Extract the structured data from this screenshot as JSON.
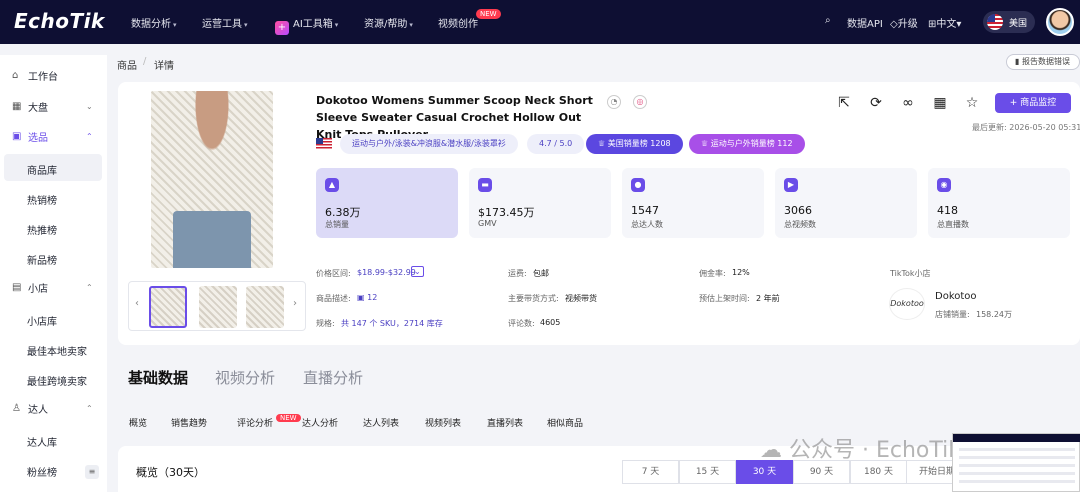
{
  "brand": "EchoTik",
  "nav": {
    "items": [
      "数据分析",
      "运营工具",
      "AI工具箱",
      "资源/帮助",
      "视频创作"
    ],
    "new_badge": "NEW",
    "right": {
      "api": "数据API",
      "upgrade": "升级",
      "language": "中文",
      "region": "美国"
    }
  },
  "sidebar": {
    "workbench": "工作台",
    "dashboard": "大盘",
    "select": "选品",
    "select_items": [
      "商品库",
      "热销榜",
      "热推榜",
      "新品榜"
    ],
    "shop": "小店",
    "shop_items": [
      "小店库",
      "最佳本地卖家",
      "最佳跨境卖家"
    ],
    "creator": "达人",
    "creator_items": [
      "达人库",
      "粉丝榜"
    ]
  },
  "breadcrumb": {
    "root": "商品",
    "current": "详情"
  },
  "report_error": "报告数据错误",
  "product": {
    "title": "Dokotoo Womens Summer Scoop Neck Short Sleeve Sweater Casual Crochet Hollow Out Knit Tops Pullover...",
    "monitor_label": "+ 商品监控",
    "last_updated": "最后更新: 2026-05-20 05:31",
    "category": "运动与户外/泳装&冲浪服&潜水服/泳装罩衫",
    "rating": "4.7 / 5.0",
    "rank_us": "美国销量榜  1208",
    "rank_outdoor": "运动与户外销量榜  112"
  },
  "stats": [
    {
      "value": "6.38万",
      "label": "总销量"
    },
    {
      "value": "$173.45万",
      "label": "GMV"
    },
    {
      "value": "1547",
      "label": "总达人数"
    },
    {
      "value": "3066",
      "label": "总视频数"
    },
    {
      "value": "418",
      "label": "总直播数"
    }
  ],
  "info": {
    "price_range_label": "价格区间:",
    "price_range": "$18.99-$32.99",
    "shipping_label": "运费:",
    "shipping": "包邮",
    "commission_label": "佣金率:",
    "commission": "12%",
    "tiktok_shop_label": "TikTok小店",
    "desc_label": "商品描述:",
    "desc": "12",
    "channel_label": "主要带货方式:",
    "channel": "视频带货",
    "listed_label": "预估上架时间:",
    "listed": "2 年前",
    "shop_name": "Dokotoo",
    "shop_logo_text": "Dokotoo",
    "shop_sales_label": "店铺销量:",
    "shop_sales": "158.24万",
    "spec_label": "规格:",
    "spec": "共 147 个 SKU，2714 库存",
    "reviews_label": "评论数:",
    "reviews": "4605"
  },
  "tabs": [
    "基础数据",
    "视频分析",
    "直播分析"
  ],
  "sub_tabs": [
    "概览",
    "销售趋势",
    "评论分析",
    "达人分析",
    "达人列表",
    "视频列表",
    "直播列表",
    "相似商品"
  ],
  "overview": {
    "title": "概览（30天）",
    "ranges": [
      "7 天",
      "15 天",
      "30 天",
      "90 天",
      "180 天"
    ],
    "selected_range": "30 天",
    "start_date": "开始日期"
  },
  "watermark": "公众号 · EchoTik"
}
